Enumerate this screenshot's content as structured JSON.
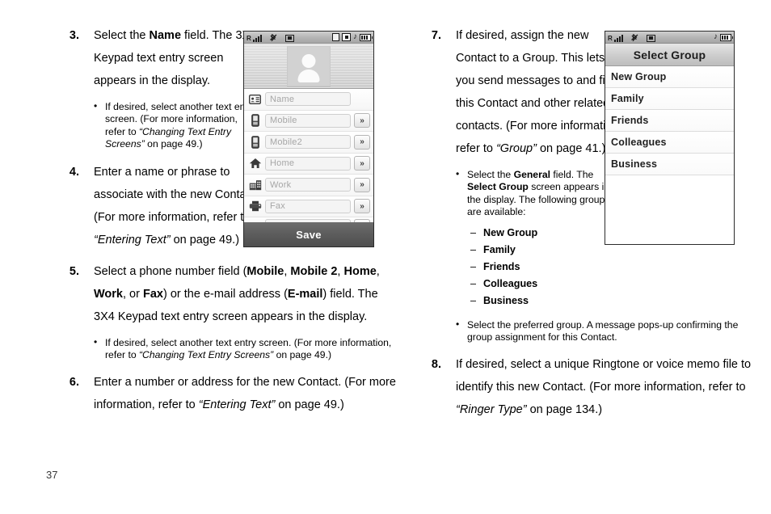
{
  "page": {
    "number": "37"
  },
  "left_column": {
    "step3": {
      "number": "3.",
      "text_parts": [
        {
          "t": "Select the ",
          "style": "normal"
        },
        {
          "t": "Name",
          "style": "bold"
        },
        {
          "t": " field. The 3X4 Keypad text entry screen appears in the display.",
          "style": "normal"
        }
      ],
      "bullets": [
        [
          {
            "t": "If desired, select another text entry screen. (For more information, refer to ",
            "style": "normal"
          },
          {
            "t": "“Changing Text Entry Screens”",
            "style": "italic"
          },
          {
            "t": " on page 49.)",
            "style": "normal"
          }
        ]
      ]
    },
    "step4": {
      "number": "4.",
      "text_parts": [
        {
          "t": "Enter a name or phrase to associate with the new Contact. (For more information, refer to ",
          "style": "normal"
        },
        {
          "t": "“Entering Text”",
          "style": "italic"
        },
        {
          "t": " on page 49.)",
          "style": "normal"
        }
      ]
    },
    "step5": {
      "number": "5.",
      "text_parts": [
        {
          "t": "Select a phone number field (",
          "style": "normal"
        },
        {
          "t": "Mobile",
          "style": "bold"
        },
        {
          "t": ", ",
          "style": "normal"
        },
        {
          "t": "Mobile 2",
          "style": "bold"
        },
        {
          "t": ", ",
          "style": "normal"
        },
        {
          "t": "Home",
          "style": "bold"
        },
        {
          "t": ", ",
          "style": "normal"
        },
        {
          "t": "Work",
          "style": "bold"
        },
        {
          "t": ", or ",
          "style": "normal"
        },
        {
          "t": "Fax",
          "style": "bold"
        },
        {
          "t": ") or the e-mail address (",
          "style": "normal"
        },
        {
          "t": "E-mail",
          "style": "bold"
        },
        {
          "t": ") field. The 3X4 Keypad text entry screen appears in the display.",
          "style": "normal"
        }
      ],
      "bullets": [
        [
          {
            "t": "If desired, select another text entry screen. (For more information, refer to ",
            "style": "normal"
          },
          {
            "t": "“Changing Text Entry Screens”",
            "style": "italic"
          },
          {
            "t": " on page 49.)",
            "style": "normal"
          }
        ]
      ]
    },
    "step6": {
      "number": "6.",
      "text_parts": [
        {
          "t": "Enter a number or address for the new Contact. (For more information, refer to ",
          "style": "normal"
        },
        {
          "t": "“Entering Text”",
          "style": "italic"
        },
        {
          "t": " on page 49.)",
          "style": "normal"
        }
      ]
    }
  },
  "right_column": {
    "step7": {
      "number": "7.",
      "text_parts": [
        {
          "t": "If desired, assign the new Contact to a Group. This lets you send messages to and find this Contact and other related contacts. (For more information, refer to ",
          "style": "normal"
        },
        {
          "t": "“Group”",
          "style": "italic"
        },
        {
          "t": " on page 41.)",
          "style": "normal"
        }
      ],
      "bullet1": [
        {
          "t": "Select the ",
          "style": "normal"
        },
        {
          "t": "General",
          "style": "bold"
        },
        {
          "t": " field. The ",
          "style": "normal"
        },
        {
          "t": "Select Group",
          "style": "bold"
        },
        {
          "t": " screen appears in the display. The following groups are available:",
          "style": "normal"
        }
      ],
      "group_options": [
        "New Group",
        "Family",
        "Friends",
        "Colleagues",
        "Business"
      ],
      "bullet2": [
        {
          "t": "Select the preferred group. A message pops-up confirming the group assignment for this Contact.",
          "style": "normal"
        }
      ]
    },
    "step8": {
      "number": "8.",
      "text_parts": [
        {
          "t": "If desired, select a unique Ringtone or voice memo file to identify this new Contact. (For more information, refer to ",
          "style": "normal"
        },
        {
          "t": "“Ringer Type”",
          "style": "italic"
        },
        {
          "t": " on page 134.)",
          "style": "normal"
        }
      ]
    }
  },
  "contact_screen": {
    "status_icons_left": [
      "roaming-signal-icon",
      "bluetooth-off-icon",
      "tty-icon"
    ],
    "status_icons_right": [
      "message-icon",
      "camera-icon",
      "music-note-icon",
      "battery-icon"
    ],
    "music_note": "♪",
    "avatar": "contact-photo-placeholder",
    "fields": [
      {
        "icon": "contact-card-icon",
        "placeholder": "Name",
        "has_chevron": false
      },
      {
        "icon": "mobile-phone-icon",
        "placeholder": "Mobile",
        "has_chevron": true
      },
      {
        "icon": "mobile-phone-icon",
        "placeholder": "Mobile2",
        "has_chevron": true
      },
      {
        "icon": "home-icon",
        "placeholder": "Home",
        "has_chevron": true
      },
      {
        "icon": "office-building-icon",
        "placeholder": "Work",
        "has_chevron": true
      },
      {
        "icon": "printer-fax-icon",
        "placeholder": "Fax",
        "has_chevron": true
      }
    ],
    "chevron_label": "»",
    "save_label": "Save"
  },
  "group_screen": {
    "status_icons_left": [
      "roaming-signal-icon",
      "bluetooth-off-icon",
      "tty-icon"
    ],
    "status_icons_right": [
      "music-note-icon",
      "battery-icon"
    ],
    "music_note": "♪",
    "title": "Select Group",
    "items": [
      "New Group",
      "Family",
      "Friends",
      "Colleagues",
      "Business"
    ]
  }
}
